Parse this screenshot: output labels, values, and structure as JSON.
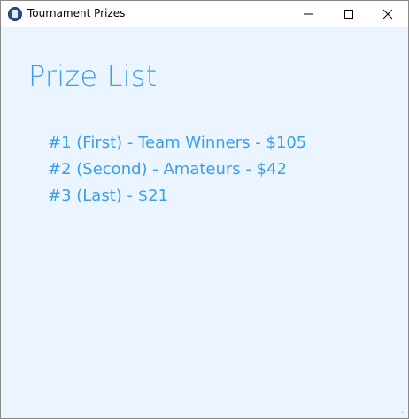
{
  "window": {
    "title": "Tournament Prizes",
    "icon": "app-icon",
    "controls": {
      "minimize_icon": "minimize-icon",
      "maximize_icon": "maximize-icon",
      "close_icon": "close-icon"
    }
  },
  "main": {
    "heading": "Prize List",
    "prizes": [
      "#1 (First) - Team Winners - $105",
      "#2 (Second) - Amateurs - $42",
      "#3 (Last) - $21"
    ]
  },
  "colors": {
    "background": "#ebf5ff",
    "accent_text": "#3d9de6",
    "titlebar": "#ffffff"
  }
}
